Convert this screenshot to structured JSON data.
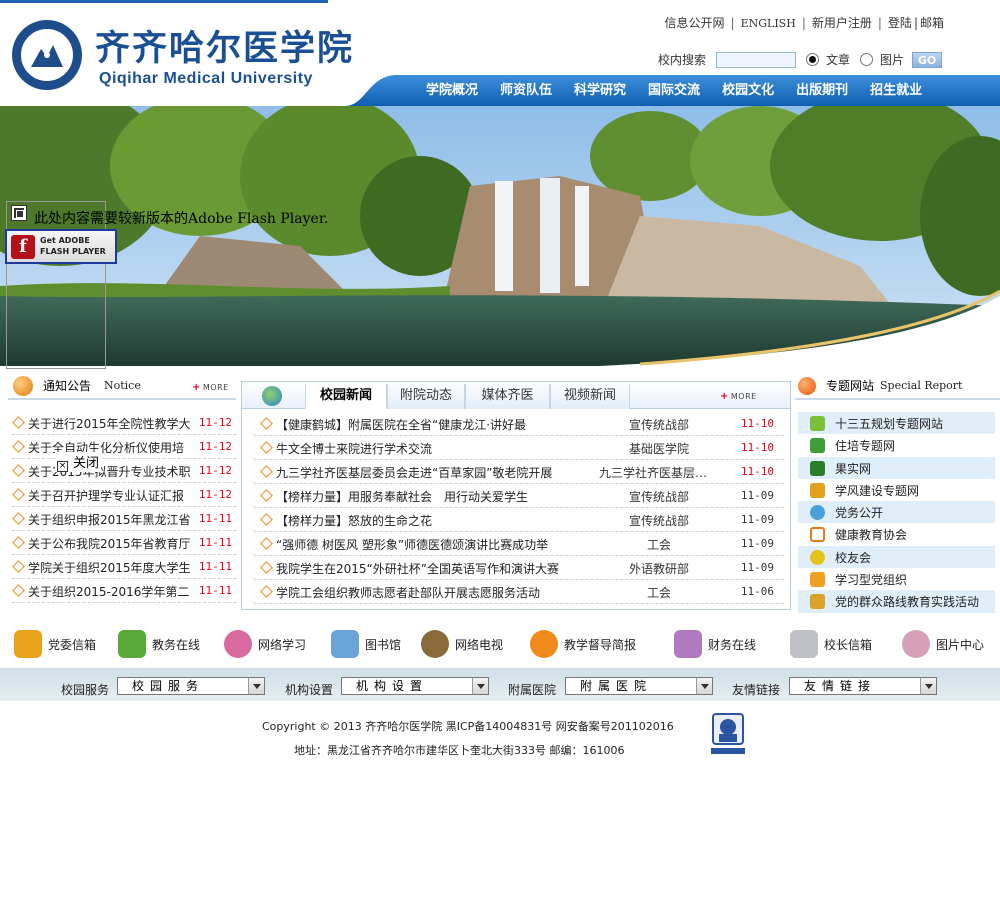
{
  "header": {
    "name_cn": "齐齐哈尔医学院",
    "name_en": "Qiqihar Medical University",
    "top_links": [
      "信息公开网",
      "ENGLISH",
      "新用户注册",
      "登陆",
      "邮箱"
    ],
    "search": {
      "label": "校内搜索",
      "value": "",
      "opt_article": "文章",
      "opt_image": "图片",
      "go": "GO",
      "selected": "文章"
    }
  },
  "nav": [
    "学院概况",
    "师资队伍",
    "科学研究",
    "国际交流",
    "校园文化",
    "出版期刊",
    "招生就业"
  ],
  "flash": {
    "notice": "此处内容需要较新版本的Adobe Flash Player.",
    "get_line1": "Get ADOBE",
    "get_line2": "FLASH PLAYER",
    "close": "关闭"
  },
  "notices": {
    "title": "通知公告",
    "title_en": "Notice",
    "more": "MORE",
    "items": [
      {
        "title": "关于进行2015年全院性教学大",
        "date": "11-12"
      },
      {
        "title": "关于全自动生化分析仪使用培",
        "date": "11-12"
      },
      {
        "title": "关于2015年拟晋升专业技术职",
        "date": "11-12"
      },
      {
        "title": "关于召开护理学专业认证汇报",
        "date": "11-12"
      },
      {
        "title": "关于组织申报2015年黑龙江省",
        "date": "11-11"
      },
      {
        "title": "关于公布我院2015年省教育厅",
        "date": "11-11"
      },
      {
        "title": "学院关于组织2015年度大学生",
        "date": "11-11"
      },
      {
        "title": "关于组织2015-2016学年第二",
        "date": "11-11"
      }
    ]
  },
  "news": {
    "tabs": [
      "校园新闻",
      "附院动态",
      "媒体齐医",
      "视频新闻"
    ],
    "active_tab": "校园新闻",
    "more": "MORE",
    "items": [
      {
        "title": "【健康鹤城】附属医院在全省“健康龙江·讲好最",
        "source": "宣传统战部",
        "date": "11-10",
        "hot": true
      },
      {
        "title": "牛文全博士来院进行学术交流",
        "source": "基础医学院",
        "date": "11-10",
        "hot": true
      },
      {
        "title": "九三学社齐医基层委员会走进“百草家园”敬老院开展",
        "source": "九三学社齐医基层委员会",
        "date": "11-10",
        "hot": true
      },
      {
        "title": "【榜样力量】用服务奉献社会　用行动关爱学生",
        "source": "宣传统战部",
        "date": "11-09",
        "hot": false
      },
      {
        "title": "【榜样力量】怒放的生命之花",
        "source": "宣传统战部",
        "date": "11-09",
        "hot": false
      },
      {
        "title": "“强师德 树医风 塑形象”师德医德颂演讲比赛成功举",
        "source": "工会",
        "date": "11-09",
        "hot": false
      },
      {
        "title": "我院学生在2015“外研社杯”全国英语写作和演讲大赛",
        "source": "外语教研部",
        "date": "11-09",
        "hot": false
      },
      {
        "title": "学院工会组织教师志愿者赴部队开展志愿服务活动",
        "source": "工会",
        "date": "11-06",
        "hot": false
      }
    ]
  },
  "special": {
    "title": "专题网站",
    "title_en": "Special Report",
    "items": [
      {
        "label": "十三五规划专题网站",
        "color": "#7bbf3a"
      },
      {
        "label": "住培专题网",
        "color": "#3f9e3a"
      },
      {
        "label": "果实网",
        "color": "#2b7f2b"
      },
      {
        "label": "学风建设专题网",
        "color": "#e2a11a"
      },
      {
        "label": "党务公开",
        "color": "#4aa0d8"
      },
      {
        "label": "健康教育协会",
        "color": "#e87a1a"
      },
      {
        "label": "校友会",
        "color": "#e3c31c"
      },
      {
        "label": "学习型党组织",
        "color": "#f0a020"
      },
      {
        "label": "党的群众路线教育实践活动",
        "color": "#d9a22b"
      }
    ]
  },
  "quick_links": [
    {
      "label": "党委信箱",
      "color": "#e8a21c"
    },
    {
      "label": "教务在线",
      "color": "#5aaa3a"
    },
    {
      "label": "网络学习",
      "color": "#d86aa0"
    },
    {
      "label": "图书馆",
      "color": "#6aa3d8"
    },
    {
      "label": "网络电视",
      "color": "#8a6a3a"
    },
    {
      "label": "教学督导简报",
      "color": "#f08a1c"
    },
    {
      "label": "财务在线",
      "color": "#b07ac0"
    },
    {
      "label": "校长信箱",
      "color": "#c0c0c8"
    },
    {
      "label": "图片中心",
      "color": "#d8a0b8"
    }
  ],
  "selects": [
    {
      "label": "校园服务",
      "value": "校园服务"
    },
    {
      "label": "机构设置",
      "value": "机构设置"
    },
    {
      "label": "附属医院",
      "value": "附属医院"
    },
    {
      "label": "友情链接",
      "value": "友情链接"
    }
  ],
  "footer": {
    "copyright": "Copyright © 2013 齐齐哈尔医学院 黑ICP备14004831号 网安备案号201102016",
    "address": "地址：黑龙江省齐齐哈尔市建华区卜奎北大街333号 邮编：161006"
  },
  "colors": {
    "brand_blue": "#1a4f93",
    "nav_blue": "#1970c3",
    "date_red": "#e2001a",
    "bullet_orange": "#f08a1c"
  }
}
